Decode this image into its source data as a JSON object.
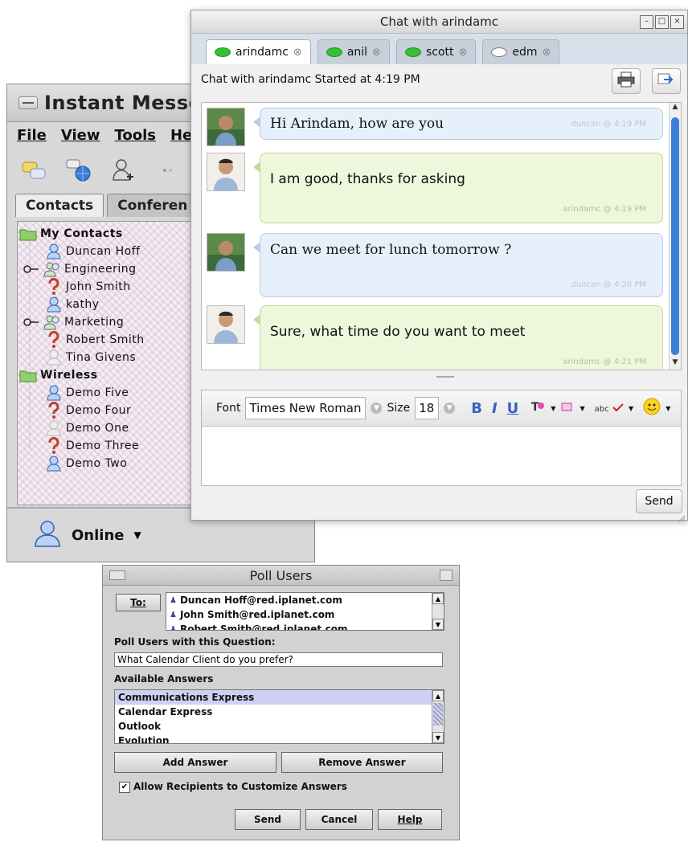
{
  "im_window": {
    "title": "Instant Messe",
    "menu": [
      "File",
      "View",
      "Tools",
      "He"
    ],
    "tabs": [
      "Contacts",
      "Conferen"
    ],
    "tree": [
      {
        "label": "My Contacts",
        "kind": "group",
        "icon": "folder-icon"
      },
      {
        "label": "Duncan Hoff",
        "kind": "user",
        "icon": "user-online-icon"
      },
      {
        "label": "Engineering",
        "kind": "subgroup",
        "icon": "group-icon"
      },
      {
        "label": "John Smith",
        "kind": "user",
        "icon": "user-unknown-icon"
      },
      {
        "label": "kathy",
        "kind": "user",
        "icon": "user-online-icon"
      },
      {
        "label": "Marketing",
        "kind": "subgroup",
        "icon": "group-icon"
      },
      {
        "label": "Robert Smith",
        "kind": "user",
        "icon": "user-unknown-icon"
      },
      {
        "label": "Tina Givens",
        "kind": "user",
        "icon": "user-offline-icon"
      },
      {
        "label": "Wireless",
        "kind": "group",
        "icon": "folder-icon"
      },
      {
        "label": "Demo Five",
        "kind": "user",
        "icon": "user-online-icon"
      },
      {
        "label": "Demo Four",
        "kind": "user",
        "icon": "user-unknown-icon"
      },
      {
        "label": "Demo One",
        "kind": "user",
        "icon": "user-offline-icon"
      },
      {
        "label": "Demo Three",
        "kind": "user",
        "icon": "user-unknown-icon"
      },
      {
        "label": "Demo Two",
        "kind": "user",
        "icon": "user-online-icon"
      }
    ],
    "status": "Online"
  },
  "chat_window": {
    "title": "Chat with arindamc",
    "tabs": [
      {
        "label": "arindamc",
        "status": "online"
      },
      {
        "label": "anil",
        "status": "online"
      },
      {
        "label": "scott",
        "status": "online"
      },
      {
        "label": "edm",
        "status": "offline"
      }
    ],
    "started": "Chat with arindamc Started at 4:19 PM",
    "messages": [
      {
        "text": "Hi Arindam, how are you",
        "stamp": "duncan @ 4:19 PM",
        "sender": "duncan",
        "style": "blue"
      },
      {
        "text": "I am good, thanks for asking",
        "stamp": "arindamc @ 4:19 PM",
        "sender": "arindamc",
        "style": "green"
      },
      {
        "text": "Can we meet for lunch tomorrow ?",
        "stamp": "duncan @ 4:20 PM",
        "sender": "duncan",
        "style": "blue"
      },
      {
        "text": "Sure, what time do you want to meet",
        "stamp": "arindamc @ 4:21 PM",
        "sender": "arindamc",
        "style": "green"
      }
    ],
    "format_bar": {
      "font_label": "Font",
      "font_value": "Times New Roman",
      "size_label": "Size",
      "size_value": "18",
      "bold": "B",
      "italic": "I",
      "underline": "U",
      "spell": "abc"
    },
    "send_label": "Send"
  },
  "poll_window": {
    "title": "Poll Users",
    "to_label": "To:",
    "recipients": [
      "Duncan Hoff@red.iplanet.com",
      "John Smith@red.iplanet.com",
      "Robert Smith@red.iplanet.com"
    ],
    "question_label": "Poll Users with this Question:",
    "question_value": "What Calendar Client do you prefer?",
    "answers_label": "Available Answers",
    "answers": [
      "Communications Express",
      "Calendar Express",
      "Outlook",
      "Evolution"
    ],
    "selected_answer_index": 0,
    "add_answer": "Add Answer",
    "remove_answer": "Remove Answer",
    "allow_customize": "Allow Recipients to Customize Answers",
    "allow_checked": true,
    "send": "Send",
    "cancel": "Cancel",
    "help": "Help"
  },
  "colors": {
    "chat_blue_bubble": "#e6f0fa",
    "chat_green_bubble": "#eef6dc",
    "online_green": "#35c135",
    "scroll_blue": "#3c7fd6",
    "selected_row": "#cfd0f2"
  }
}
